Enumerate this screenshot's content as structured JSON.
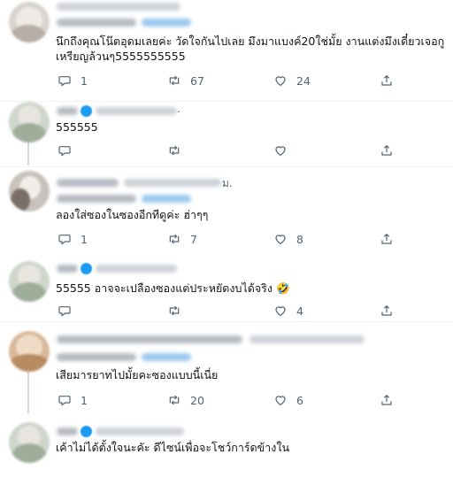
{
  "tweets": [
    {
      "name_tail": "",
      "text": "นึกถึงคุณโน๊ตอุดมเลยค่ะ วัดใจกันไปเลย มึงมาแบงค์20ใช่มั้ย งานแต่งมึงเดี๋ยวเจอกู\nเหรียญล้วนๆ5555555555",
      "replies": "1",
      "retweets": "67",
      "likes": "24"
    },
    {
      "name_tail": ".",
      "text": "555555",
      "replies": "",
      "retweets": "",
      "likes": ""
    },
    {
      "name_tail": "ม.",
      "text": "ลองใส่ซองในซองอีกทีดูค่ะ ฮ่าๆๆ",
      "replies": "1",
      "retweets": "7",
      "likes": "8"
    },
    {
      "name_tail": "",
      "text": "55555 อาจจะเปลืองซองแต่ประหยัดงบได้จริง 🤣",
      "replies": "",
      "retweets": "",
      "likes": "4"
    },
    {
      "name_tail": "",
      "text": "เสียมารยาทไปมั้ยคะซองแบบนี้เนี่ย",
      "replies": "1",
      "retweets": "20",
      "likes": "6"
    },
    {
      "name_tail": "",
      "text": "เค้าไม่ได้ตั้งใจนะคัะ ดีไซน์เพื่อจะโชว์การ์ดข้างใน",
      "replies": "",
      "retweets": "",
      "likes": ""
    }
  ],
  "icons": {
    "reply": "reply-icon",
    "retweet": "retweet-icon",
    "like": "heart-icon",
    "share": "share-icon",
    "verified": "verified-badge-icon"
  },
  "colors": {
    "text": "#0f1419",
    "muted": "#536471",
    "verified": "#1d9bf0",
    "divider": "#eff3f4"
  }
}
